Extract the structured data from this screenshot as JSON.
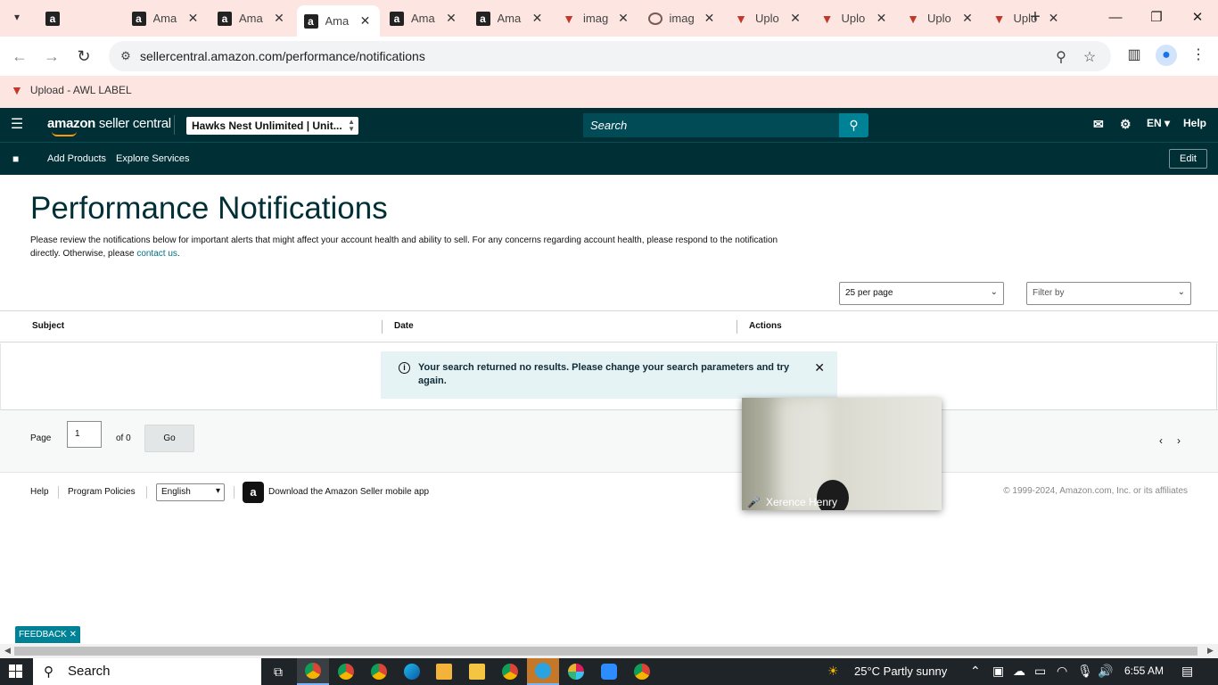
{
  "browser": {
    "tabs": [
      {
        "label": "",
        "favicon": "amazon-a",
        "closable": false
      },
      {
        "label": "Ama",
        "favicon": "amazon-a"
      },
      {
        "label": "Ama",
        "favicon": "amazon-a"
      },
      {
        "label": "Ama",
        "favicon": "amazon-a",
        "active": true
      },
      {
        "label": "Ama",
        "favicon": "amazon-a"
      },
      {
        "label": "Ama",
        "favicon": "amazon-a"
      },
      {
        "label": "imag",
        "favicon": "awl-v"
      },
      {
        "label": "imag",
        "favicon": "circle-o"
      },
      {
        "label": "Uplo",
        "favicon": "awl-v"
      },
      {
        "label": "Uplo",
        "favicon": "awl-v"
      },
      {
        "label": "Uplo",
        "favicon": "awl-v"
      },
      {
        "label": "Uplo",
        "favicon": "awl-v"
      }
    ],
    "url": "sellercentral.amazon.com/performance/notifications",
    "bookmark": "Upload - AWL LABEL"
  },
  "header": {
    "logo_main": "amazon",
    "logo_sub": " seller central",
    "store": "Hawks Nest Unlimited | Unit...",
    "search_placeholder": "Search",
    "language": "EN",
    "help": "Help"
  },
  "subnav": {
    "links": [
      "Add Products",
      "Explore Services"
    ],
    "edit": "Edit"
  },
  "page": {
    "title": "Performance Notifications",
    "intro": "Please review the notifications below for important alerts that might affect your account health and ability to sell. For any concerns regarding account health, please respond to the notification directly. Otherwise, please ",
    "contact_link": "contact us",
    "intro_end": ".",
    "per_page": "25 per page",
    "filter": "Filter by",
    "columns": [
      "Subject",
      "Date",
      "Actions"
    ],
    "alert": "Your search returned no results. Please change your search parameters and try again.",
    "pager": {
      "page_label": "Page",
      "page_value": "1",
      "of_label": "of 0",
      "go": "Go"
    }
  },
  "footer": {
    "help": "Help",
    "policies": "Program Policies",
    "language": "English",
    "app": "Download the Amazon Seller mobile app",
    "copyright": "© 1999-2024, Amazon.com, Inc. or its affiliates"
  },
  "video": {
    "name": "Xerence Henry"
  },
  "feedback": "FEEDBACK",
  "taskbar": {
    "search": "Search",
    "weather": "25°C  Partly sunny",
    "time": "6:55 AM"
  },
  "colors": {
    "header_bg": "#002f36",
    "accent": "#008296",
    "tab_strip": "#fde6e1"
  }
}
